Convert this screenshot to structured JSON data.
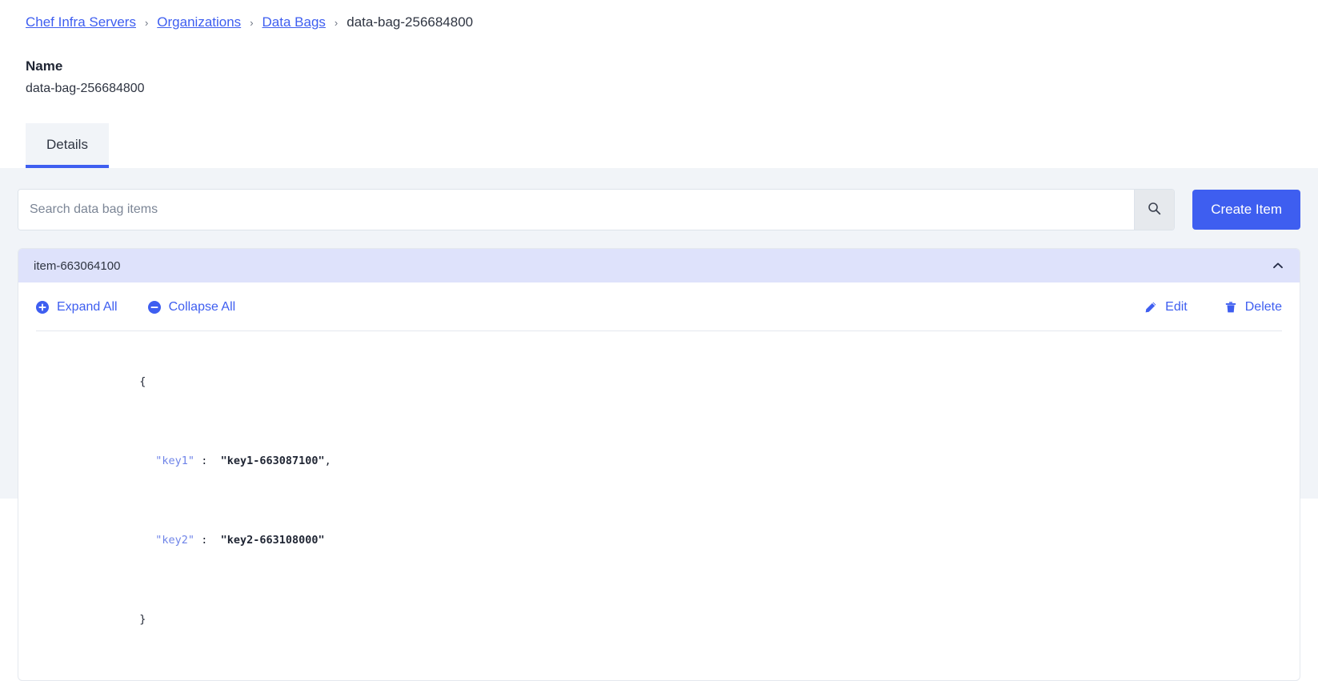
{
  "breadcrumb": {
    "items": [
      {
        "label": "Chef Infra Servers",
        "link": true
      },
      {
        "label": "Organizations",
        "link": true
      },
      {
        "label": "Data Bags",
        "link": true
      },
      {
        "label": "data-bag-256684800",
        "link": false
      }
    ],
    "separator": "›"
  },
  "header": {
    "name_label": "Name",
    "name_value": "data-bag-256684800"
  },
  "tabs": [
    {
      "label": "Details",
      "active": true
    }
  ],
  "search": {
    "placeholder": "Search data bag items",
    "value": "",
    "search_icon": "search-icon"
  },
  "actions": {
    "create_label": "Create Item"
  },
  "item": {
    "title": "item-663064100",
    "expanded": true,
    "collapse_icon": "chevron-up-icon",
    "toolbar": {
      "expand_all": "Expand All",
      "collapse_all": "Collapse All",
      "edit": "Edit",
      "delete": "Delete"
    },
    "json": {
      "open_brace": "{",
      "close_brace": "}",
      "entries": [
        {
          "key": "\"key1\"",
          "colon": ":",
          "value": "\"key1-663087100\"",
          "comma": ","
        },
        {
          "key": "\"key2\"",
          "colon": ":",
          "value": "\"key2-663108000\"",
          "comma": ""
        }
      ]
    }
  },
  "colors": {
    "accent": "#3e5ef0",
    "page_bg": "#f1f4f8",
    "item_header_bg": "#dee2fb",
    "search_btn_bg": "#e6e9ed"
  }
}
